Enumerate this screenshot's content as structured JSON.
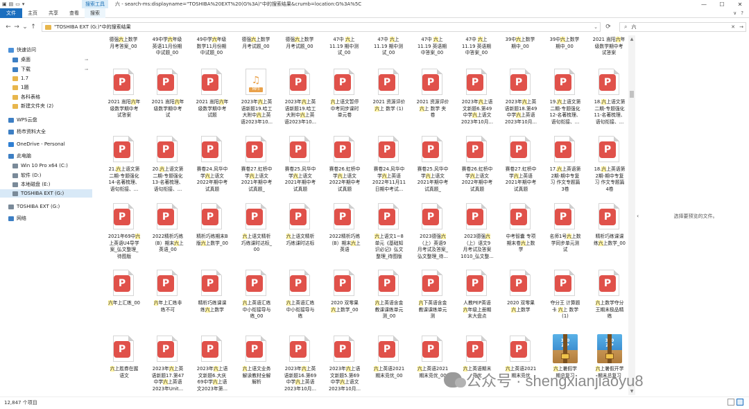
{
  "window": {
    "context_tab": "搜索工具",
    "title": "六 - search-ms:displayname=\"TOSHIBA%20EXT%20(G%3A)\"中的搜索结果&crumb=location:G%3A%5C",
    "min": "—",
    "max": "☐",
    "close": "✕"
  },
  "ribbon": {
    "tabs": [
      {
        "label": "文件"
      },
      {
        "label": "主页"
      },
      {
        "label": "共享"
      },
      {
        "label": "查看"
      },
      {
        "label": "搜索"
      }
    ],
    "right": [
      "∨",
      "?"
    ]
  },
  "address": {
    "path": "\"TOSHIBA EXT (G:)\"中的搜索结果",
    "search_value": "六"
  },
  "nav": {
    "items": [
      {
        "label": "快速访问",
        "color": "#4a90d9",
        "pinned": false,
        "indent": 0
      },
      {
        "label": "桌面",
        "color": "#3d7fc4",
        "pinned": true,
        "indent": 1
      },
      {
        "label": "下载",
        "color": "#3d7fc4",
        "pinned": true,
        "indent": 1
      },
      {
        "label": "1.7",
        "color": "#e8b64c",
        "pinned": false,
        "indent": 1
      },
      {
        "label": "1題",
        "color": "#e8b64c",
        "pinned": false,
        "indent": 1
      },
      {
        "label": "各科表格",
        "color": "#e8b64c",
        "pinned": false,
        "indent": 1
      },
      {
        "label": "新建文件夹 (2)",
        "color": "#e8b64c",
        "pinned": false,
        "indent": 1
      },
      {
        "label": "WPS云盘",
        "color": "#3d7fc4",
        "pinned": false,
        "indent": 0
      },
      {
        "label": "杨市资料大全",
        "color": "#3d7fc4",
        "pinned": false,
        "indent": 0
      },
      {
        "label": "OneDrive - Personal",
        "color": "#2f7fd3",
        "pinned": false,
        "indent": 0
      },
      {
        "label": "此电脑",
        "color": "#3d7fc4",
        "pinned": false,
        "indent": 0
      },
      {
        "label": "Win 10 Pro x64 (C:)",
        "color": "#7a8a99",
        "pinned": false,
        "indent": 1
      },
      {
        "label": "软件 (D:)",
        "color": "#7a8a99",
        "pinned": false,
        "indent": 1
      },
      {
        "label": "本地磁盘 (E:)",
        "color": "#7a8a99",
        "pinned": false,
        "indent": 1
      },
      {
        "label": "TOSHIBA EXT (G:)",
        "color": "#7a8a99",
        "pinned": false,
        "indent": 1,
        "selected": true
      },
      {
        "label": "TOSHIBA EXT (G:)",
        "color": "#7a8a99",
        "pinned": false,
        "indent": 0
      },
      {
        "label": "网络",
        "color": "#3d7fc4",
        "pinned": false,
        "indent": 0
      }
    ]
  },
  "files": {
    "top_labels": [
      "德强六上数学\n月考答案_00",
      "49中学六年级\n英语11月份期\n中试题_00",
      "49中学六年级\n数学11月份期\n中试题_00",
      "德强六上数学\n月考试题_00",
      "德强六上数学\n月考试题_00",
      "47中 六上\n11.19 期中测\n试_00",
      "47中 六上\n11.19 期中测\n试_00",
      "47中 六上\n11.19 英语期\n中答案_00",
      "47中 六上\n11.19 英语期\n中答案_00",
      "39中六上数学\n期中_00",
      "39中六上数学\n期中_00",
      "2021 嵩阳六年\n级数学期中考\n试答案"
    ],
    "rows": [
      [
        {
          "type": "ppt",
          "label": "2021 嵩阳六年\n级数学期中考\n试答案"
        },
        {
          "type": "ppt",
          "label": "2021 嵩阳六年\n级数学期中考\n试"
        },
        {
          "type": "ppt",
          "label": "2021 嵩阳六年\n级数学期中考\n试题"
        },
        {
          "type": "mp3",
          "label": "2023年六上英\n语新题19.哈工\n大附中六上英\n语2023年10...",
          "tag": "MP3"
        },
        {
          "type": "ppt",
          "label": "2023年六上英\n语新题19.哈工\n大附中六上英\n语2023年10..."
        },
        {
          "type": "ppt",
          "label": "六上语文暂停\n中考同步课时\n单元卷"
        },
        {
          "type": "ppt",
          "label": "2021 资源评价\n六上 数学 (1)"
        },
        {
          "type": "ppt",
          "label": "2021 资源评价\n六上 数学 夹\n卷"
        },
        {
          "type": "ppt",
          "label": "2023年六上语\n文新题6.第49\n中学六上语文\n2023年10月..."
        },
        {
          "type": "ppt",
          "label": "2023年六上英\n语新题18.第49\n中学六上英语\n2023年10月..."
        },
        {
          "type": "ppt",
          "label": "19.六上语文第\n二期-专题强化\n12-名著梳理、\n语句衔接、..."
        },
        {
          "type": "ppt",
          "label": "18.六上语文第\n二期-专题强化\n11-名著梳理、\n语句衔接、..."
        }
      ],
      [
        {
          "type": "ppt",
          "label": "21.六上语文第\n二期-专题强化\n14-名著梳理、\n语句衔接、..."
        },
        {
          "type": "ppt",
          "label": "20.六上语文第\n二期-专题强化\n13-名著梳理、\n语句衔接、..."
        },
        {
          "type": "ppt",
          "label": "赛卷24.风华中\n学六上语文\n2022年期中考\n试真题"
        },
        {
          "type": "ppt",
          "label": "赛卷27.虹桥中\n学六上语文\n2021年期中考\n试真题_"
        },
        {
          "type": "ppt",
          "label": "赛卷25.风华中\n学六上语文\n2021年期中考\n试真题"
        },
        {
          "type": "ppt",
          "label": "赛卷26.虹桥中\n学六上语文\n2022年期中考\n试真题"
        },
        {
          "type": "ppt",
          "label": "赛卷24.风华中\n学六上英语\n2022年11月11\n日期中考试..."
        },
        {
          "type": "ppt",
          "label": "赛卷25.风华中\n学六上语文\n2021年期中考\n试真题_"
        },
        {
          "type": "ppt",
          "label": "赛卷26.虹桥中\n学六上语文\n2022年期中考\n试真题"
        },
        {
          "type": "ppt",
          "label": "赛卷27.虹桥中\n学六上英语\n2021年期中考\n试真题"
        },
        {
          "type": "ppt",
          "label": "17.六上英语第\n2期-期中专复\n习 作文专题篇\n3卷"
        },
        {
          "type": "ppt",
          "label": "18.六上英语第\n2期-期中专复\n习 作文专题篇\n4卷"
        }
      ],
      [
        {
          "type": "ppt",
          "label": "2021年69中六\n上英语U4导学\n案_弘文整理_\n待图版"
        },
        {
          "type": "ppt",
          "label": "2022精析巧练\n（B）期末六上\n英语_00"
        },
        {
          "type": "ppt",
          "label": "精析巧练期末B\n版六上数学_00"
        },
        {
          "type": "ppt",
          "label": "六上语文精析\n巧练课时达标_\n00"
        },
        {
          "type": "ppt",
          "label": "六上语文精析\n巧练课时达标"
        },
        {
          "type": "ppt",
          "label": "2022精析巧练\n（B）期末六上\n英语"
        },
        {
          "type": "ppt",
          "label": "六上语文1~8\n单元《基础知\n识必记》弘文\n整理_待图版"
        },
        {
          "type": "ppt",
          "label": "2023德强六\n（上）英语9\n月考试及答案_\n弘文整理_待..."
        },
        {
          "type": "ppt",
          "label": "2023德强六\n（上）语文9\n月考试及答案\n1010_弘文整..."
        },
        {
          "type": "ppt",
          "label": "中考智囊 专项\n期末卷六上数\n学"
        },
        {
          "type": "ppt",
          "label": "名师1号六上数\n学同步单元测\n试"
        },
        {
          "type": "ppt",
          "label": "精析巧练课课\n练六上数学_00"
        }
      ],
      [
        {
          "type": "ppt",
          "label": "六年上汇练_00"
        },
        {
          "type": "ppt",
          "label": "六年上汇练非\n练不可"
        },
        {
          "type": "ppt",
          "label": "精析巧练课课\n练六上数学"
        },
        {
          "type": "ppt",
          "label": "六上英语汇练\n中小衔接导与\n练_00"
        },
        {
          "type": "ppt",
          "label": "六上英语汇练\n中小衔接导与\n练"
        },
        {
          "type": "ppt",
          "label": "2020 双零果\n六上数学_00"
        },
        {
          "type": "ppt",
          "label": "六上英语含金\n教课课练单元\n测_00"
        },
        {
          "type": "ppt",
          "label": "六下英语含金\n教课课练单元\n测"
        },
        {
          "type": "ppt",
          "label": "人教PEP英语\n六年级上册期\n末大盘点"
        },
        {
          "type": "ppt",
          "label": "2020 双零果\n六上数学"
        },
        {
          "type": "ppt",
          "label": "夺分王 计算题\n卡 六上 数学\n(1)"
        },
        {
          "type": "ppt",
          "label": "六上数学夺分\n王期末极品精\n练"
        }
      ],
      [
        {
          "type": "ppt",
          "label": "六上胜券在握\n语文"
        },
        {
          "type": "ppt",
          "label": "2023年六上英\n语新题17.第47\n中学六上英语\n2023年Unit..."
        },
        {
          "type": "ppt",
          "label": "2023年六上语\n文新题6.大庆\n69中学六上语\n文2023年第..."
        },
        {
          "type": "ppt",
          "label": "六上语文业务\n解读教材全解\n解析"
        },
        {
          "type": "ppt",
          "label": "2023年六上英\n语新题16.第69\n中学六上英语\n2023年10月..."
        },
        {
          "type": "ppt",
          "label": "2023年六上语\n文新题5.第69\n中学六上语文\n2023年10月..."
        },
        {
          "type": "ppt",
          "label": "六上英语2021\n期末竞优_00"
        },
        {
          "type": "ppt",
          "label": "六上英语2021\n期末竞优_00"
        },
        {
          "type": "ppt",
          "label": "六上英语期末\n竞优"
        },
        {
          "type": "ppt",
          "label": "六上英语2021\n期末竞优"
        },
        {
          "type": "zip",
          "label": "六上暑假学\n期总复习",
          "tag": "360\nZIP"
        },
        {
          "type": "zip",
          "label": "六上暑假开学\n期末总复习",
          "tag": "360\nZIP"
        }
      ]
    ]
  },
  "preview": {
    "message": "选择要预览的文件。"
  },
  "status": {
    "count": "12,847 个项目"
  },
  "watermark": {
    "text": "公众号 · shengxianjiaoyu8"
  },
  "colors": {
    "accent": "#1c6fbf",
    "ppt": "#e0514a",
    "highlight": "#fff3a3"
  }
}
